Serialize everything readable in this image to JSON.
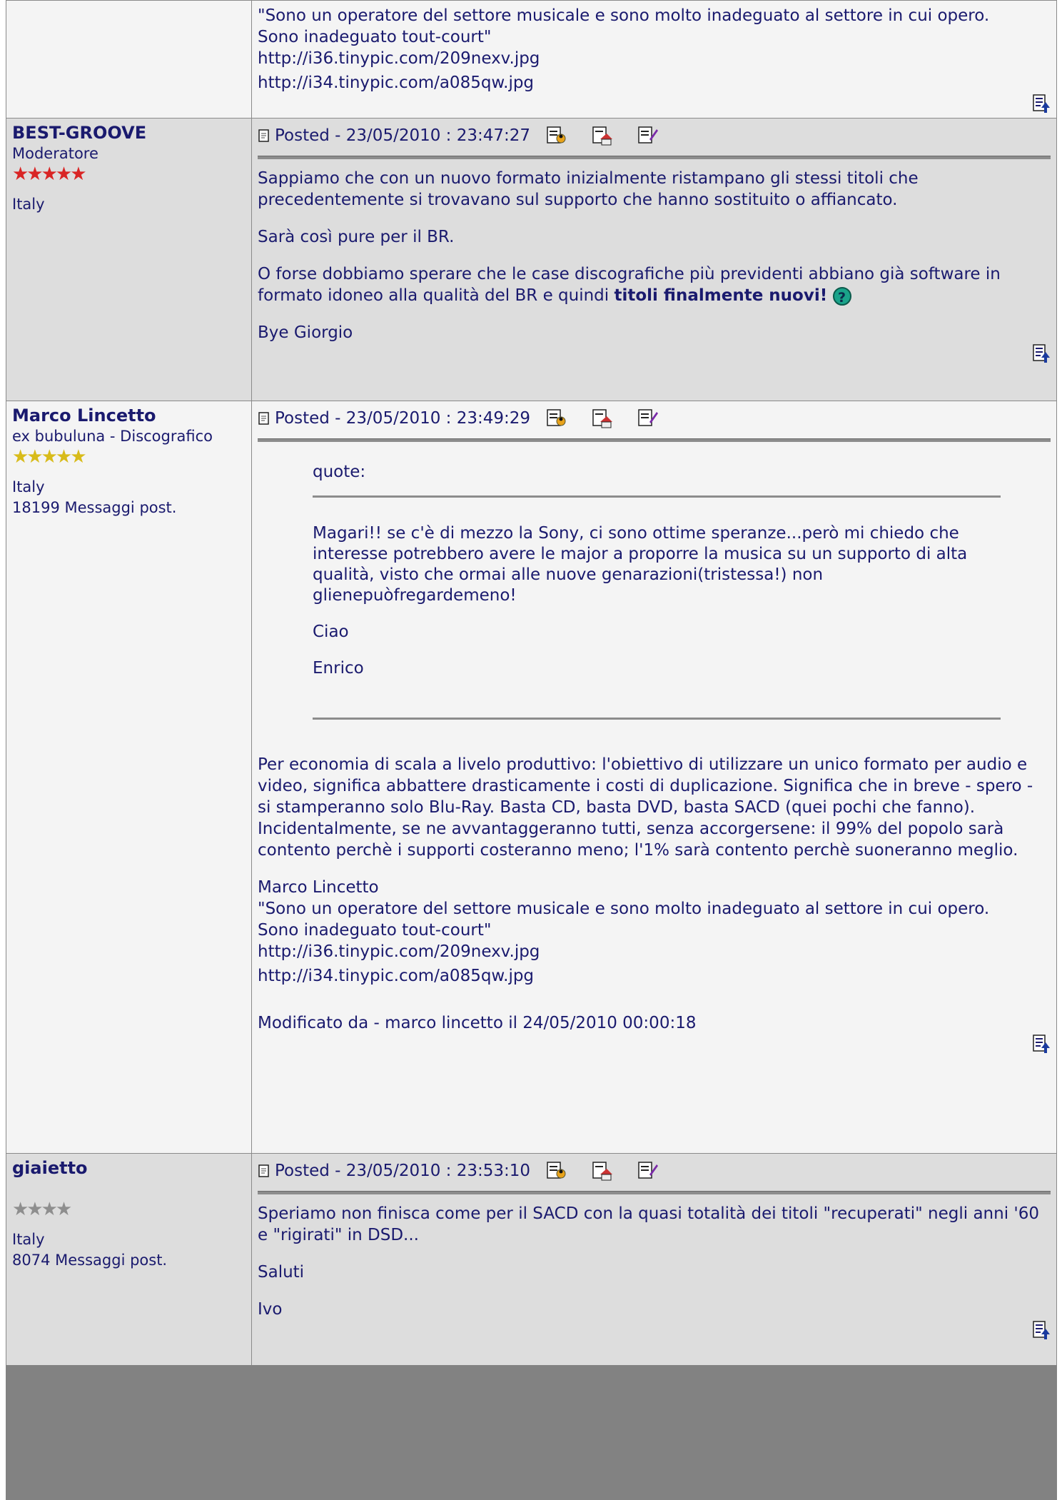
{
  "post0": {
    "sig_quote_l1": "\"Sono un operatore del settore musicale e sono molto inadeguato al settore in cui opero.",
    "sig_quote_l2": "Sono inadeguato tout-court\"",
    "link1": "http://i36.tinypic.com/209nexv.jpg",
    "link2": "http://i34.tinypic.com/a085qw.jpg"
  },
  "post1": {
    "author": "BEST-GROOVE",
    "role": "Moderatore",
    "stars": "★★★★★",
    "country": "Italy",
    "posted": "Posted - 23/05/2010 :  23:47:27",
    "p1": "Sappiamo che con un nuovo formato inizialmente ristampano gli stessi titoli che precedentemente si trovavano sul supporto che hanno sostituito o affiancato.",
    "p2": "Sarà così pure per il BR.",
    "p3": "O forse dobbiamo sperare che le case discografiche più previdenti abbiano già software in formato idoneo alla qualità del BR e quindi ",
    "p3_bold": "titoli finalmente nuovi!",
    "smiley": "?",
    "p4": "Bye Giorgio"
  },
  "post2": {
    "author": "Marco Lincetto",
    "role": "ex bubuluna - Discografico",
    "stars": "★★★★★",
    "country": "Italy",
    "count": "18199 Messaggi post.",
    "posted": "Posted - 23/05/2010 :  23:49:29",
    "quote_label": "quote:",
    "quote_p1": "Magari!! se c'è di mezzo la Sony, ci sono ottime speranze...però mi chiedo che interesse potrebbero avere le major a proporre la musica su un supporto di alta qualità, visto che ormai alle nuove genarazioni(tristessa!) non glienepuòfregardemeno!",
    "quote_p2": "Ciao",
    "quote_p3": "Enrico",
    "p1": "Per economia di scala a livelo produttivo: l'obiettivo di utilizzare un unico formato per audio e video, significa abbattere drasticamente i costi di duplicazione. Significa che in breve - spero - si stamperanno solo Blu-Ray. Basta CD, basta DVD, basta SACD (quei pochi che fanno).",
    "p2": "Incidentalmente, se ne avvantaggeranno tutti, senza accorgersene: il 99% del popolo sarà contento perchè i supporti costeranno meno; l'1% sarà contento perchè suoneranno meglio.",
    "sig_name": "Marco Lincetto",
    "sig_quote_l1": "\"Sono un operatore del settore musicale e sono molto inadeguato al settore in cui opero.",
    "sig_quote_l2": "Sono inadeguato tout-court\"",
    "link1": "http://i36.tinypic.com/209nexv.jpg",
    "link2": "http://i34.tinypic.com/a085qw.jpg",
    "modified": "Modificato da - marco lincetto il 24/05/2010 00:00:18"
  },
  "post3": {
    "author": "giaietto",
    "stars": "★★★★",
    "country": "Italy",
    "count": "8074 Messaggi post.",
    "posted": "Posted - 23/05/2010 :  23:53:10",
    "p1": "Speriamo non finisca come per il SACD con la quasi totalità dei titoli \"recuperati\" negli anni '60 e \"rigirati\" in DSD...",
    "p2": "Saluti",
    "p3": "Ivo"
  },
  "colors": {
    "text": "#1a1a6e",
    "row_light": "#f4f4f4",
    "row_dark": "#dddddd",
    "footer": "#828282",
    "star_red": "#d92525",
    "star_gold": "#d8bb1a",
    "star_grey": "#8e8e8e"
  },
  "icons": [
    "post-icon",
    "profile-icon",
    "homepage-icon",
    "edit-icon",
    "go-to-top-icon",
    "question-smiley-icon"
  ]
}
